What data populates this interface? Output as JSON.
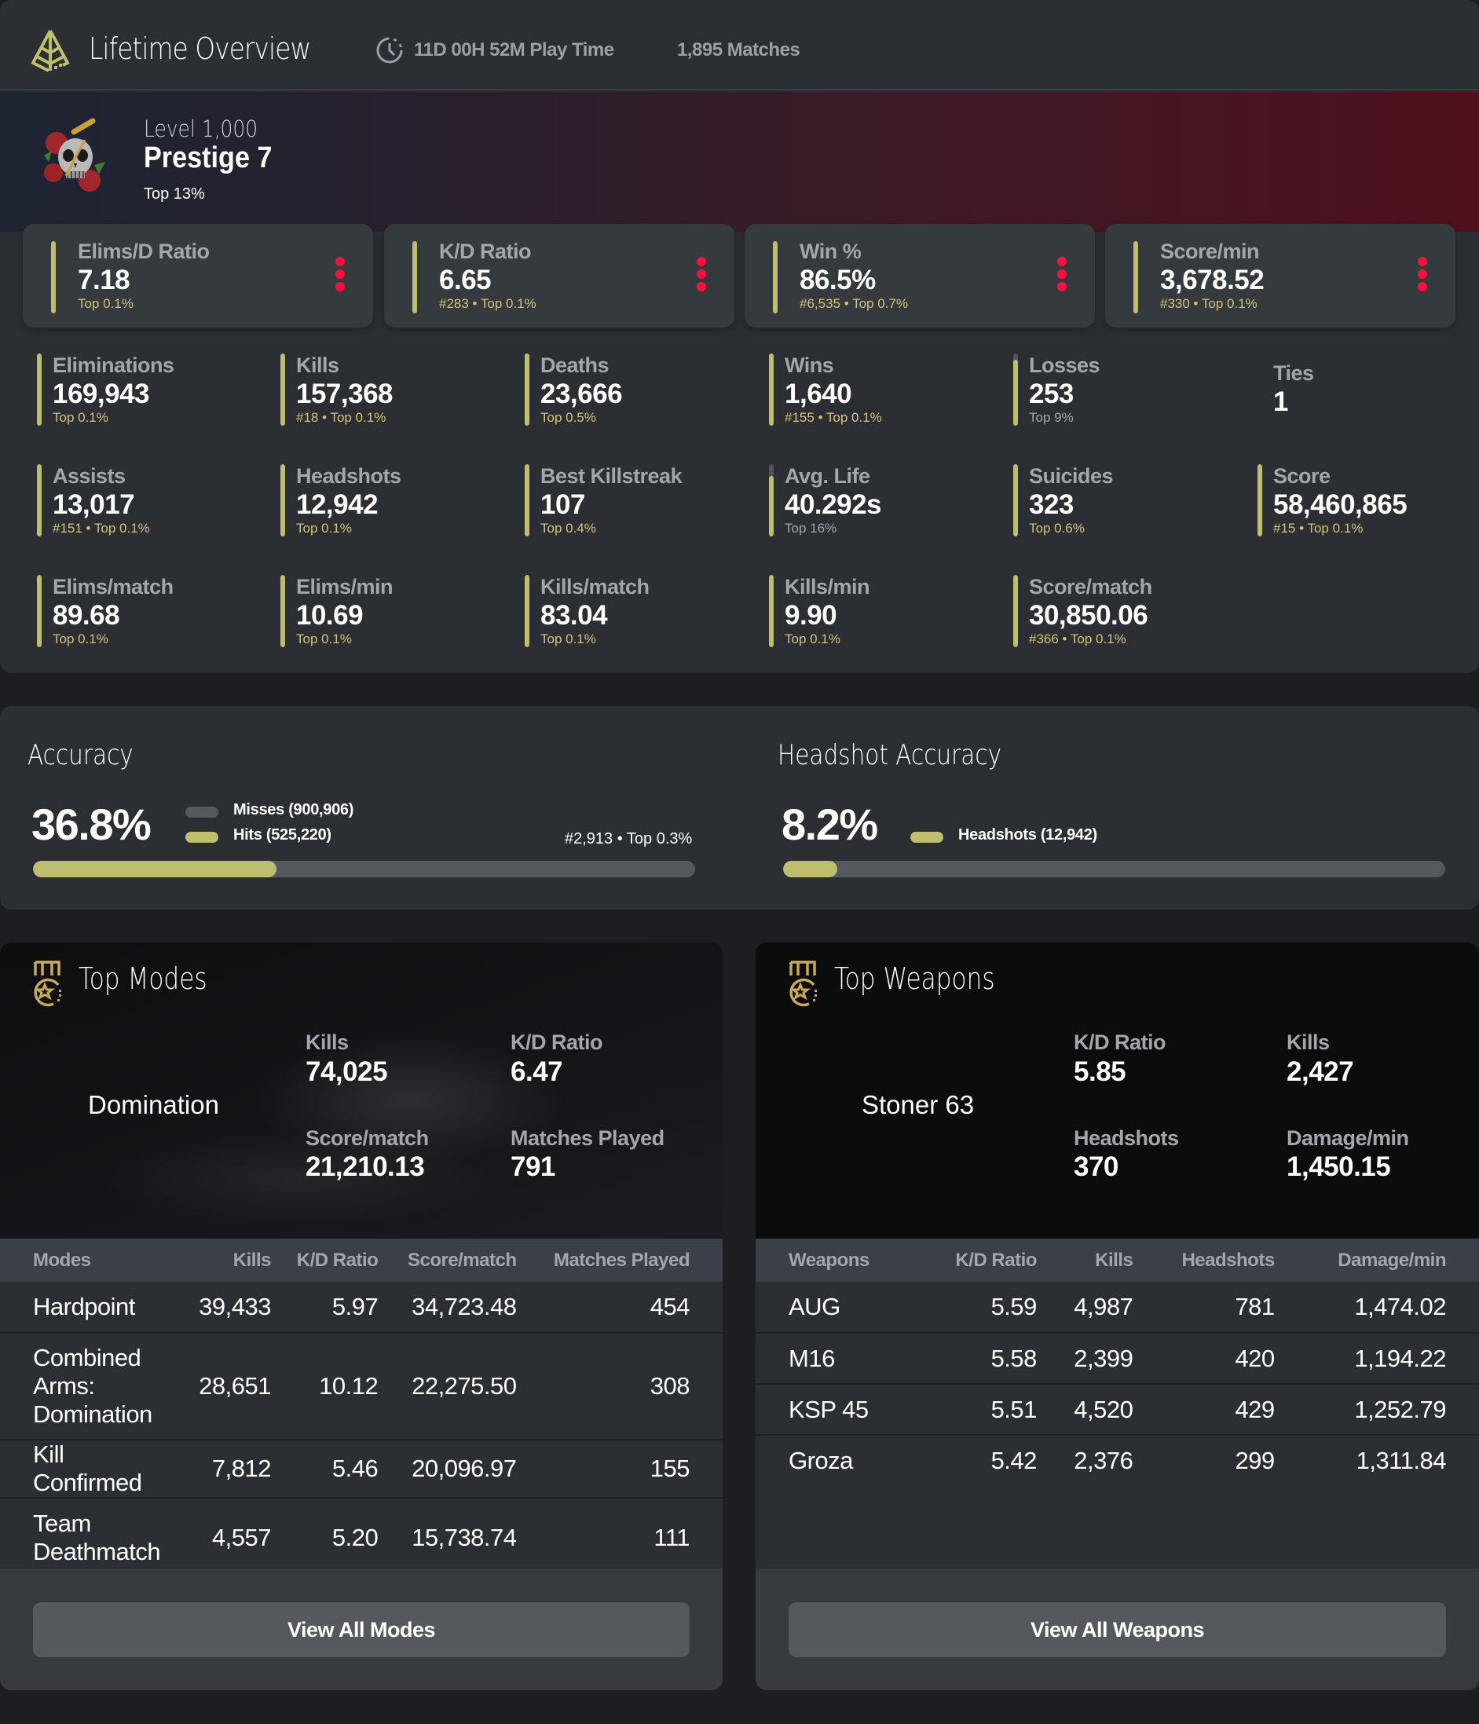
{
  "header": {
    "title": "Lifetime Overview",
    "logo_icon": "pyramid-logo-icon",
    "playtime_icon": "clock-icon",
    "playtime": "11D 00H 52M Play Time",
    "matches": "1,895 Matches"
  },
  "hero": {
    "avatar": "skull-roses-dagger-emblem",
    "level": "Level 1,000",
    "prestige": "Prestige 7",
    "rank": "Top 13%"
  },
  "top_cards": [
    {
      "label": "Elims/D Ratio",
      "value": "7.18",
      "rank": "Top 0.1%"
    },
    {
      "label": "K/D Ratio",
      "value": "6.65",
      "rank": "#283 • Top 0.1%"
    },
    {
      "label": "Win %",
      "value": "86.5%",
      "rank": "#6,535 • Top 0.7%"
    },
    {
      "label": "Score/min",
      "value": "3,678.52",
      "rank": "#330 • Top 0.1%"
    }
  ],
  "stats": [
    {
      "label": "Eliminations",
      "value": "169,943",
      "rank": "Top 0.1%",
      "percentile_fill": 1.0,
      "highlight": true
    },
    {
      "label": "Kills",
      "value": "157,368",
      "rank": "#18 • Top 0.1%",
      "percentile_fill": 1.0,
      "highlight": true
    },
    {
      "label": "Deaths",
      "value": "23,666",
      "rank": "Top 0.5%",
      "percentile_fill": 1.0,
      "highlight": true
    },
    {
      "label": "Wins",
      "value": "1,640",
      "rank": "#155 • Top 0.1%",
      "percentile_fill": 1.0,
      "highlight": true
    },
    {
      "label": "Losses",
      "value": "253",
      "rank": "Top 9%",
      "percentile_fill": 0.91,
      "highlight": false
    },
    {
      "label": "Ties",
      "value": "1",
      "rank": "",
      "percentile_fill": null,
      "highlight": false
    },
    {
      "label": "Assists",
      "value": "13,017",
      "rank": "#151 • Top 0.1%",
      "percentile_fill": 1.0,
      "highlight": true
    },
    {
      "label": "Headshots",
      "value": "12,942",
      "rank": "Top 0.1%",
      "percentile_fill": 1.0,
      "highlight": true
    },
    {
      "label": "Best Killstreak",
      "value": "107",
      "rank": "Top 0.4%",
      "percentile_fill": 1.0,
      "highlight": true
    },
    {
      "label": "Avg. Life",
      "value": "40.292s",
      "rank": "Top 16%",
      "percentile_fill": 0.84,
      "highlight": false
    },
    {
      "label": "Suicides",
      "value": "323",
      "rank": "Top 0.6%",
      "percentile_fill": 1.0,
      "highlight": true
    },
    {
      "label": "Score",
      "value": "58,460,865",
      "rank": "#15 • Top 0.1%",
      "percentile_fill": 1.0,
      "highlight": true
    },
    {
      "label": "Elims/match",
      "value": "89.68",
      "rank": "Top 0.1%",
      "percentile_fill": 1.0,
      "highlight": true
    },
    {
      "label": "Elims/min",
      "value": "10.69",
      "rank": "Top 0.1%",
      "percentile_fill": 1.0,
      "highlight": true
    },
    {
      "label": "Kills/match",
      "value": "83.04",
      "rank": "Top 0.1%",
      "percentile_fill": 1.0,
      "highlight": true
    },
    {
      "label": "Kills/min",
      "value": "9.90",
      "rank": "Top 0.1%",
      "percentile_fill": 1.0,
      "highlight": true
    },
    {
      "label": "Score/match",
      "value": "30,850.06",
      "rank": "#366 • Top 0.1%",
      "percentile_fill": 1.0,
      "highlight": true
    }
  ],
  "accuracy": {
    "title": "Accuracy",
    "value": "36.8%",
    "fraction": 0.368,
    "misses_label": "Misses",
    "misses_count": "(900,906)",
    "hits_label": "Hits",
    "hits_count": "(525,220)",
    "rank": "#2,913 • Top 0.3%"
  },
  "headshot_accuracy": {
    "title": "Headshot Accuracy",
    "value": "8.2%",
    "fraction": 0.082,
    "headshots_label": "Headshots",
    "headshots_count": "(12,942)"
  },
  "top_modes": {
    "title": "Top Modes",
    "featured": {
      "name": "Domination",
      "stats": [
        {
          "label": "Kills",
          "value": "74,025"
        },
        {
          "label": "K/D Ratio",
          "value": "6.47"
        },
        {
          "label": "Score/match",
          "value": "21,210.13"
        },
        {
          "label": "Matches Played",
          "value": "791"
        }
      ]
    },
    "columns": [
      "Modes",
      "Kills",
      "K/D Ratio",
      "Score/match",
      "Matches Played"
    ],
    "rows": [
      [
        "Hardpoint",
        "39,433",
        "5.97",
        "34,723.48",
        "454"
      ],
      [
        "Combined Arms: Domination",
        "28,651",
        "10.12",
        "22,275.50",
        "308"
      ],
      [
        "Kill Confirmed",
        "7,812",
        "5.46",
        "20,096.97",
        "155"
      ],
      [
        "Team Deathmatch",
        "4,557",
        "5.20",
        "15,738.74",
        "111"
      ]
    ],
    "button": "View All Modes"
  },
  "top_weapons": {
    "title": "Top Weapons",
    "featured": {
      "name": "Stoner 63",
      "stats": [
        {
          "label": "K/D Ratio",
          "value": "5.85"
        },
        {
          "label": "Kills",
          "value": "2,427"
        },
        {
          "label": "Headshots",
          "value": "370"
        },
        {
          "label": "Damage/min",
          "value": "1,450.15"
        }
      ]
    },
    "columns": [
      "Weapons",
      "K/D Ratio",
      "Kills",
      "Headshots",
      "Damage/min"
    ],
    "rows": [
      [
        "AUG",
        "5.59",
        "4,987",
        "781",
        "1,474.02"
      ],
      [
        "M16",
        "5.58",
        "2,399",
        "420",
        "1,194.22"
      ],
      [
        "KSP 45",
        "5.51",
        "4,520",
        "429",
        "1,252.79"
      ],
      [
        "Groza",
        "5.42",
        "2,376",
        "299",
        "1,311.84"
      ]
    ],
    "button": "View All Weapons"
  },
  "colors": {
    "accent_gold": "#bfbd6e",
    "rank_gold": "#d8c277",
    "menu_red": "#ff0f3c",
    "panel": "#2b2e33",
    "page": "#1d1e21"
  }
}
